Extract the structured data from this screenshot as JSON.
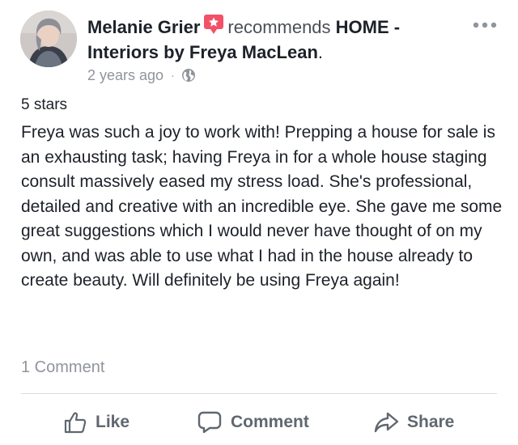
{
  "post": {
    "author": "Melanie Grier",
    "verb": "recommends",
    "page_name": "HOME - Interiors by Freya MacLean",
    "period": ".",
    "timestamp": "2 years ago",
    "separator": "·",
    "audience_icon": "globe-icon",
    "badge_icon": "recommend-star-icon",
    "more_icon": "ellipsis-icon",
    "rating": "5 stars",
    "review_text": "Freya was such a joy to work with! Prepping a house for sale is an exhausting task; having Freya in for a whole house staging consult massively eased my stress load. She's professional, detailed and creative with an incredible eye. She gave me some great suggestions which I would never have thought of on my own, and was able to use what I had in the house already to create beauty. Will definitely be using Freya again!"
  },
  "footer": {
    "comment_count": "1 Comment",
    "like_label": "Like",
    "comment_label": "Comment",
    "share_label": "Share"
  },
  "colors": {
    "badge": "#f25268",
    "text_primary": "#1d2129",
    "text_secondary": "#90949c",
    "action_text": "#606770",
    "divider": "#dadde1"
  }
}
